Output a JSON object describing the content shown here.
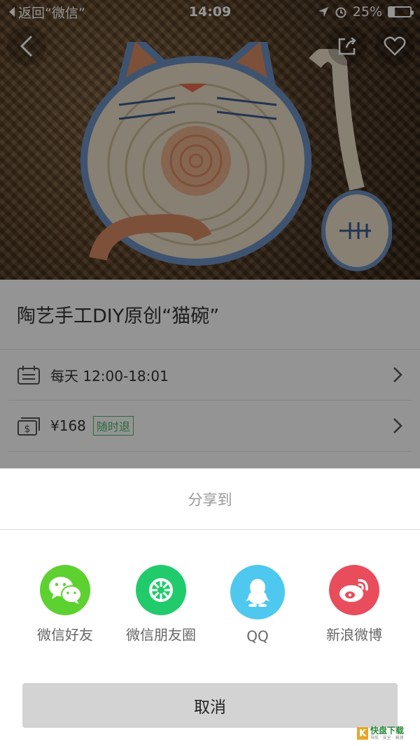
{
  "status_bar": {
    "back_label": "返回“微信”",
    "time": "14:09",
    "battery": "25%",
    "battery_level": 0.25
  },
  "product": {
    "title": "陶艺手工DIY原创“猫碗”",
    "schedule": "每天 12:00-18:01",
    "price": "¥168",
    "refund_badge": "随时退"
  },
  "share_sheet": {
    "title": "分享到",
    "options": [
      {
        "label": "微信好友",
        "icon": "wechat-icon",
        "color": "#5dd12f"
      },
      {
        "label": "微信朋友圈",
        "icon": "moments-icon",
        "color": "#21cb6b"
      },
      {
        "label": "QQ",
        "icon": "qq-icon",
        "color": "#4ec8ee"
      },
      {
        "label": "新浪微博",
        "icon": "weibo-icon",
        "color": "#e94d5c"
      }
    ],
    "cancel_label": "取消"
  },
  "watermark": {
    "logo_text": "K",
    "brand": "快盘下载",
    "tagline": "导航 · 安全 · 高速"
  }
}
